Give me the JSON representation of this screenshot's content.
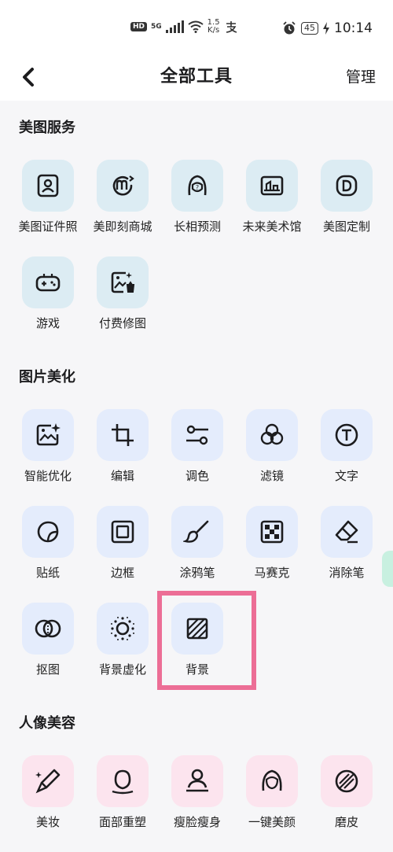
{
  "status_bar": {
    "hd": "HD",
    "network": "5G",
    "speed_value": "1.5",
    "speed_unit": "K/s",
    "battery": "45",
    "time": "10:14"
  },
  "header": {
    "title": "全部工具",
    "manage_label": "管理"
  },
  "sections": {
    "meitu_services": {
      "title": "美图服务",
      "items": [
        {
          "label": "美图证件照",
          "icon": "id-photo-icon"
        },
        {
          "label": "美即刻商城",
          "icon": "shop-icon"
        },
        {
          "label": "长相预测",
          "icon": "face-predict-icon"
        },
        {
          "label": "未来美术馆",
          "icon": "gallery-icon"
        },
        {
          "label": "美图定制",
          "icon": "custom-icon"
        },
        {
          "label": "游戏",
          "icon": "gamepad-icon"
        },
        {
          "label": "付费修图",
          "icon": "paid-retouch-icon"
        }
      ]
    },
    "image_beautify": {
      "title": "图片美化",
      "items": [
        {
          "label": "智能优化",
          "icon": "smart-optimize-icon"
        },
        {
          "label": "编辑",
          "icon": "crop-icon"
        },
        {
          "label": "调色",
          "icon": "adjust-icon"
        },
        {
          "label": "滤镜",
          "icon": "filter-icon"
        },
        {
          "label": "文字",
          "icon": "text-icon"
        },
        {
          "label": "贴纸",
          "icon": "sticker-icon"
        },
        {
          "label": "边框",
          "icon": "frame-icon"
        },
        {
          "label": "涂鸦笔",
          "icon": "brush-icon"
        },
        {
          "label": "马赛克",
          "icon": "mosaic-icon"
        },
        {
          "label": "消除笔",
          "icon": "eraser-icon"
        },
        {
          "label": "抠图",
          "icon": "cutout-icon"
        },
        {
          "label": "背景虚化",
          "icon": "blur-icon"
        },
        {
          "label": "背景",
          "icon": "background-icon"
        }
      ]
    },
    "portrait_beauty": {
      "title": "人像美容",
      "items": [
        {
          "label": "美妆",
          "icon": "makeup-icon"
        },
        {
          "label": "面部重塑",
          "icon": "face-reshape-icon"
        },
        {
          "label": "瘦脸瘦身",
          "icon": "slim-icon"
        },
        {
          "label": "一键美颜",
          "icon": "one-tap-beauty-icon"
        },
        {
          "label": "磨皮",
          "icon": "smooth-skin-icon"
        }
      ]
    }
  },
  "colors": {
    "tile_services": "#dcecf3",
    "tile_beautify": "#e4ecfc",
    "tile_portrait": "#fce4ee",
    "highlight": "#ec6e96"
  }
}
